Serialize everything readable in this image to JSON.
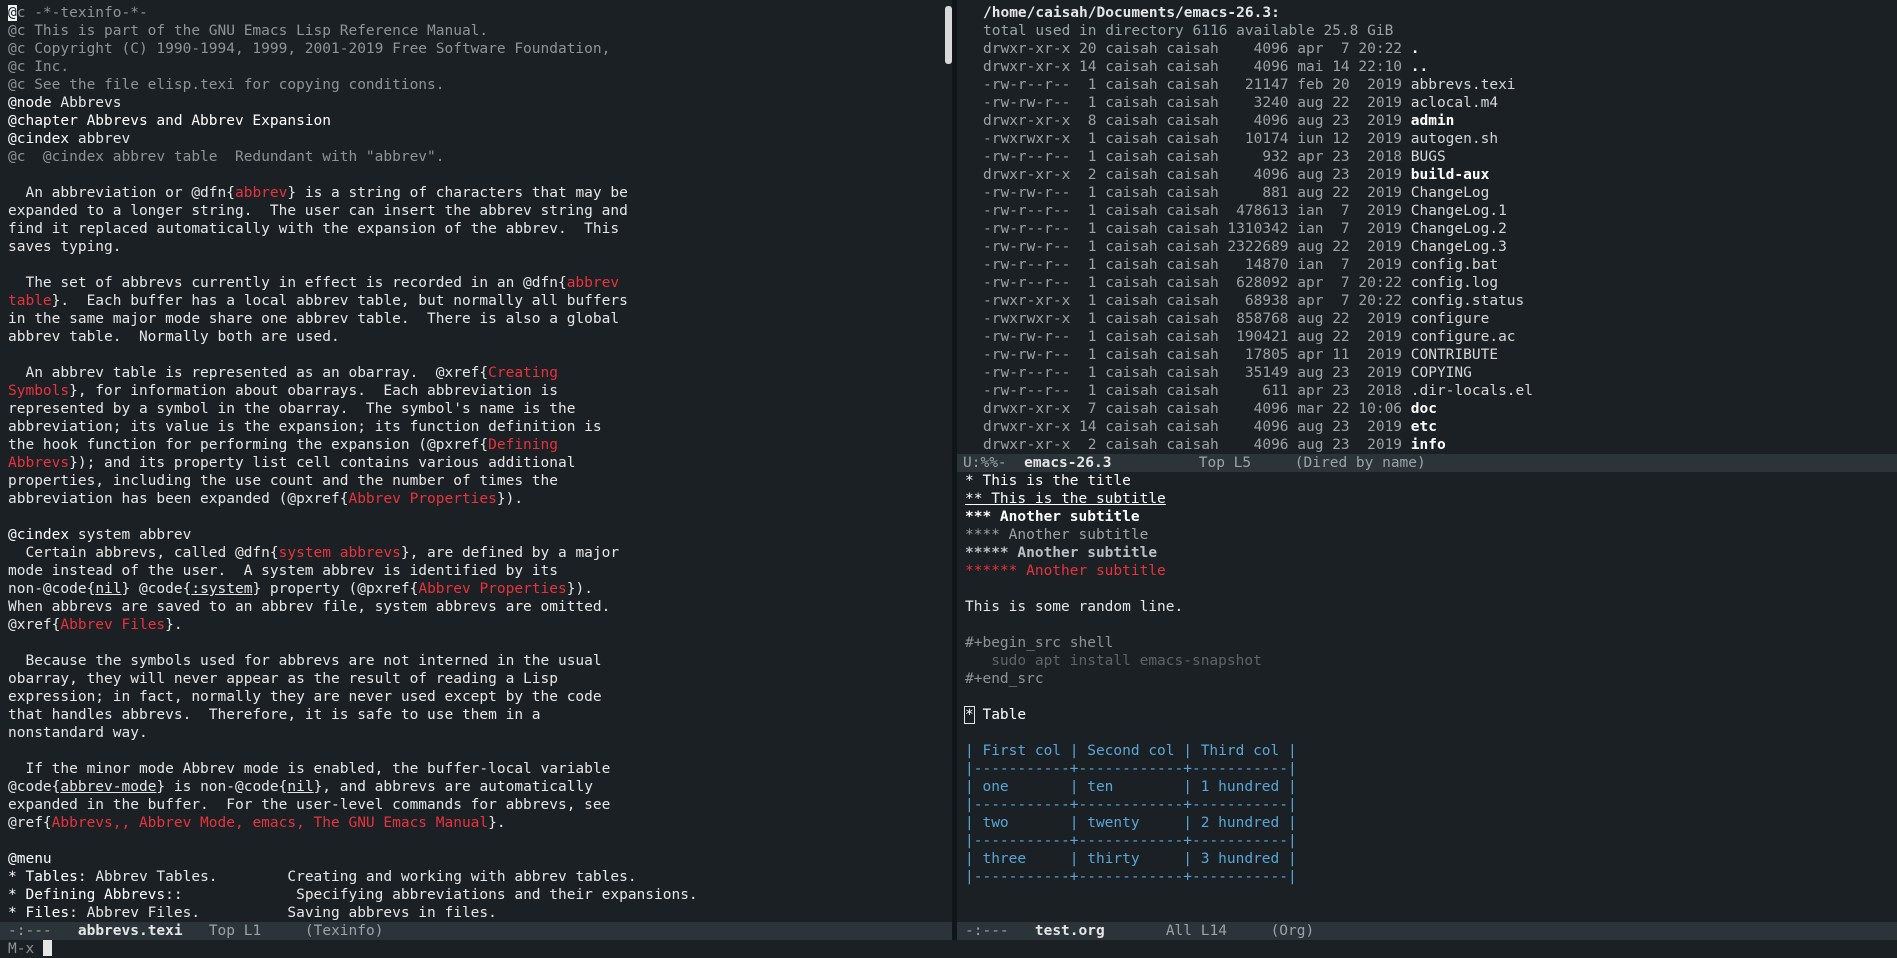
{
  "left": {
    "lines": [
      [
        {
          "t": "@c -*-texinfo-*-",
          "c": "cm"
        }
      ],
      [
        {
          "t": "@c This is part of the GNU Emacs Lisp Reference Manual.",
          "c": "cm"
        }
      ],
      [
        {
          "t": "@c Copyright (C) 1990-1994, 1999, 2001-2019 Free Software Foundation,",
          "c": "cm"
        }
      ],
      [
        {
          "t": "@c Inc.",
          "c": "cm"
        }
      ],
      [
        {
          "t": "@c See the file elisp.texi for copying conditions.",
          "c": "cm"
        }
      ],
      [
        {
          "t": "@node ",
          "c": "kw"
        },
        {
          "t": "Abbrevs"
        }
      ],
      [
        {
          "t": "@chapter Abbrevs and Abbrev Expansion",
          "c": "kw"
        }
      ],
      [
        {
          "t": "@cindex ",
          "c": "kw"
        },
        {
          "t": "abbrev"
        }
      ],
      [
        {
          "t": "@c  @cindex abbrev table  Redundant with \"abbrev\".",
          "c": "cm"
        }
      ],
      [
        {
          "t": ""
        }
      ],
      [
        {
          "t": "  An abbreviation or @dfn{"
        },
        {
          "t": "abbrev",
          "c": "red"
        },
        {
          "t": "} is a string of characters that may be"
        }
      ],
      [
        {
          "t": "expanded to a longer string.  The user can insert the abbrev string and"
        }
      ],
      [
        {
          "t": "find it replaced automatically with the expansion of the abbrev.  This"
        }
      ],
      [
        {
          "t": "saves typing."
        }
      ],
      [
        {
          "t": ""
        }
      ],
      [
        {
          "t": "  The set of abbrevs currently in effect is recorded in an @dfn{"
        },
        {
          "t": "abbrev",
          "c": "red"
        }
      ],
      [
        {
          "t": "table",
          "c": "red"
        },
        {
          "t": "}.  Each buffer has a local abbrev table, but normally all buffers"
        }
      ],
      [
        {
          "t": "in the same major mode share one abbrev table.  There is also a global"
        }
      ],
      [
        {
          "t": "abbrev table.  Normally both are used."
        }
      ],
      [
        {
          "t": ""
        }
      ],
      [
        {
          "t": "  An abbrev table is represented as an obarray.  @xref{"
        },
        {
          "t": "Creating",
          "c": "red"
        }
      ],
      [
        {
          "t": "Symbols",
          "c": "red"
        },
        {
          "t": "}, for information about obarrays.  Each abbreviation is"
        }
      ],
      [
        {
          "t": "represented by a symbol in the obarray.  The symbol's name is the"
        }
      ],
      [
        {
          "t": "abbreviation; its value is the expansion; its function definition is"
        }
      ],
      [
        {
          "t": "the hook function for performing the expansion (@pxref{"
        },
        {
          "t": "Defining",
          "c": "red"
        }
      ],
      [
        {
          "t": "Abbrevs",
          "c": "red"
        },
        {
          "t": "}); and its property list cell contains various additional"
        }
      ],
      [
        {
          "t": "properties, including the use count and the number of times the"
        }
      ],
      [
        {
          "t": "abbreviation has been expanded (@pxref{"
        },
        {
          "t": "Abbrev Properties",
          "c": "red"
        },
        {
          "t": "})."
        }
      ],
      [
        {
          "t": ""
        }
      ],
      [
        {
          "t": "@cindex ",
          "c": "kw"
        },
        {
          "t": "system abbrev"
        }
      ],
      [
        {
          "t": "  Certain abbrevs, called @dfn{"
        },
        {
          "t": "system abbrevs",
          "c": "red"
        },
        {
          "t": "}, are defined by a major"
        }
      ],
      [
        {
          "t": "mode instead of the user.  A system abbrev is identified by its"
        }
      ],
      [
        {
          "t": "non-@code{"
        },
        {
          "t": "nil",
          "c": "ul"
        },
        {
          "t": "} @code{"
        },
        {
          "t": ":system",
          "c": "ul"
        },
        {
          "t": "} property (@pxref{"
        },
        {
          "t": "Abbrev Properties",
          "c": "red"
        },
        {
          "t": "})."
        }
      ],
      [
        {
          "t": "When abbrevs are saved to an abbrev file, system abbrevs are omitted."
        }
      ],
      [
        {
          "t": "@xref{"
        },
        {
          "t": "Abbrev Files",
          "c": "red"
        },
        {
          "t": "}."
        }
      ],
      [
        {
          "t": ""
        }
      ],
      [
        {
          "t": "  Because the symbols used for abbrevs are not interned in the usual"
        }
      ],
      [
        {
          "t": "obarray, they will never appear as the result of reading a Lisp"
        }
      ],
      [
        {
          "t": "expression; in fact, normally they are never used except by the code"
        }
      ],
      [
        {
          "t": "that handles abbrevs.  Therefore, it is safe to use them in a"
        }
      ],
      [
        {
          "t": "nonstandard way."
        }
      ],
      [
        {
          "t": ""
        }
      ],
      [
        {
          "t": "  If the minor mode Abbrev mode is enabled, the buffer-local variable"
        }
      ],
      [
        {
          "t": "@code{"
        },
        {
          "t": "abbrev-mode",
          "c": "ul"
        },
        {
          "t": "} is non-@code{"
        },
        {
          "t": "nil",
          "c": "ul"
        },
        {
          "t": "}, and abbrevs are automatically"
        }
      ],
      [
        {
          "t": "expanded in the buffer.  For the user-level commands for abbrevs, see"
        }
      ],
      [
        {
          "t": "@ref{"
        },
        {
          "t": "Abbrevs,, Abbrev Mode, emacs, The GNU Emacs Manual",
          "c": "red"
        },
        {
          "t": "}."
        }
      ],
      [
        {
          "t": ""
        }
      ],
      [
        {
          "t": "@menu",
          "c": "kw"
        }
      ],
      [
        {
          "t": "* Tables: ",
          "c": "kw"
        },
        {
          "t": "Abbrev Tables.        Creating and working with abbrev tables."
        }
      ],
      [
        {
          "t": "* Defining Abbrevs::",
          "c": "kw"
        },
        {
          "t": "             Specifying abbreviations and their expansions."
        }
      ],
      [
        {
          "t": "* Files: ",
          "c": "kw"
        },
        {
          "t": "Abbrev Files.          Saving abbrevs in files."
        }
      ]
    ],
    "modeline": {
      "status": "-:---",
      "buffer": "abbrevs.texi",
      "position": "Top L1",
      "mode": "(Texinfo)"
    }
  },
  "dired": {
    "header": "/home/caisah/Documents/emacs-26.3:",
    "total": "total used in directory 6116 available 25.8 GiB",
    "entries": [
      {
        "perm": "drwxr-xr-x",
        "links": "20",
        "user": "caisah",
        "group": "caisah",
        "size": "4096",
        "date": "apr  7 20:22",
        "name": ".",
        "dir": true
      },
      {
        "perm": "drwxr-xr-x",
        "links": "14",
        "user": "caisah",
        "group": "caisah",
        "size": "4096",
        "date": "mai 14 22:10",
        "name": "..",
        "dir": true
      },
      {
        "perm": "-rw-r--r--",
        "links": "1",
        "user": "caisah",
        "group": "caisah",
        "size": "21147",
        "date": "feb 20  2019",
        "name": "abbrevs.texi",
        "dir": false
      },
      {
        "perm": "-rw-rw-r--",
        "links": "1",
        "user": "caisah",
        "group": "caisah",
        "size": "3240",
        "date": "aug 22  2019",
        "name": "aclocal.m4",
        "dir": false
      },
      {
        "perm": "drwxr-xr-x",
        "links": "8",
        "user": "caisah",
        "group": "caisah",
        "size": "4096",
        "date": "aug 23  2019",
        "name": "admin",
        "dir": true
      },
      {
        "perm": "-rwxrwxr-x",
        "links": "1",
        "user": "caisah",
        "group": "caisah",
        "size": "10174",
        "date": "iun 12  2019",
        "name": "autogen.sh",
        "dir": false
      },
      {
        "perm": "-rw-r--r--",
        "links": "1",
        "user": "caisah",
        "group": "caisah",
        "size": "932",
        "date": "apr 23  2018",
        "name": "BUGS",
        "dir": false
      },
      {
        "perm": "drwxr-xr-x",
        "links": "2",
        "user": "caisah",
        "group": "caisah",
        "size": "4096",
        "date": "aug 23  2019",
        "name": "build-aux",
        "dir": true
      },
      {
        "perm": "-rw-rw-r--",
        "links": "1",
        "user": "caisah",
        "group": "caisah",
        "size": "881",
        "date": "aug 22  2019",
        "name": "ChangeLog",
        "dir": false
      },
      {
        "perm": "-rw-r--r--",
        "links": "1",
        "user": "caisah",
        "group": "caisah",
        "size": "478613",
        "date": "ian  7  2019",
        "name": "ChangeLog.1",
        "dir": false
      },
      {
        "perm": "-rw-r--r--",
        "links": "1",
        "user": "caisah",
        "group": "caisah",
        "size": "1310342",
        "date": "ian  7  2019",
        "name": "ChangeLog.2",
        "dir": false
      },
      {
        "perm": "-rw-rw-r--",
        "links": "1",
        "user": "caisah",
        "group": "caisah",
        "size": "2322689",
        "date": "aug 22  2019",
        "name": "ChangeLog.3",
        "dir": false
      },
      {
        "perm": "-rw-r--r--",
        "links": "1",
        "user": "caisah",
        "group": "caisah",
        "size": "14870",
        "date": "ian  7  2019",
        "name": "config.bat",
        "dir": false
      },
      {
        "perm": "-rw-r--r--",
        "links": "1",
        "user": "caisah",
        "group": "caisah",
        "size": "628092",
        "date": "apr  7 20:22",
        "name": "config.log",
        "dir": false
      },
      {
        "perm": "-rwxr-xr-x",
        "links": "1",
        "user": "caisah",
        "group": "caisah",
        "size": "68938",
        "date": "apr  7 20:22",
        "name": "config.status",
        "dir": false
      },
      {
        "perm": "-rwxrwxr-x",
        "links": "1",
        "user": "caisah",
        "group": "caisah",
        "size": "858768",
        "date": "aug 22  2019",
        "name": "configure",
        "dir": false
      },
      {
        "perm": "-rw-rw-r--",
        "links": "1",
        "user": "caisah",
        "group": "caisah",
        "size": "190421",
        "date": "aug 22  2019",
        "name": "configure.ac",
        "dir": false
      },
      {
        "perm": "-rw-rw-r--",
        "links": "1",
        "user": "caisah",
        "group": "caisah",
        "size": "17805",
        "date": "apr 11  2019",
        "name": "CONTRIBUTE",
        "dir": false
      },
      {
        "perm": "-rw-r--r--",
        "links": "1",
        "user": "caisah",
        "group": "caisah",
        "size": "35149",
        "date": "aug 23  2019",
        "name": "COPYING",
        "dir": false
      },
      {
        "perm": "-rw-r--r--",
        "links": "1",
        "user": "caisah",
        "group": "caisah",
        "size": "611",
        "date": "apr 23  2018",
        "name": ".dir-locals.el",
        "dir": false
      },
      {
        "perm": "drwxr-xr-x",
        "links": "7",
        "user": "caisah",
        "group": "caisah",
        "size": "4096",
        "date": "mar 22 10:06",
        "name": "doc",
        "dir": true
      },
      {
        "perm": "drwxr-xr-x",
        "links": "14",
        "user": "caisah",
        "group": "caisah",
        "size": "4096",
        "date": "aug 23  2019",
        "name": "etc",
        "dir": true
      },
      {
        "perm": "drwxr-xr-x",
        "links": "2",
        "user": "caisah",
        "group": "caisah",
        "size": "4096",
        "date": "aug 23  2019",
        "name": "info",
        "dir": true
      }
    ],
    "modeline": {
      "status": "U:%%-",
      "buffer": "emacs-26.3",
      "position": "Top L5",
      "mode": "(Dired by name)"
    }
  },
  "org": {
    "lines": [
      {
        "t": "* This is the title",
        "c": "org1"
      },
      {
        "t": "** This is the subtitle",
        "c": "org2"
      },
      {
        "t": "*** Another subtitle",
        "c": "org3"
      },
      {
        "t": "**** Another subtitle",
        "c": "org4"
      },
      {
        "t": "***** Another subtitle",
        "c": "org5"
      },
      {
        "t": "****** Another subtitle",
        "c": "org6"
      },
      {
        "t": "",
        "c": ""
      },
      {
        "t": "This is some random line.",
        "c": ""
      },
      {
        "t": "",
        "c": ""
      },
      {
        "t": "#+begin_src shell",
        "c": "src"
      },
      {
        "t": "   sudo apt install emacs-snapshot",
        "c": "srcbody"
      },
      {
        "t": "#+end_src",
        "c": "src"
      },
      {
        "t": "",
        "c": ""
      },
      {
        "t": "* Table",
        "c": "org1",
        "cursor": true
      },
      {
        "t": "",
        "c": ""
      },
      {
        "t": "| First col | Second col | Third col |",
        "c": "tbl"
      },
      {
        "t": "|-----------+------------+-----------|",
        "c": "tbl"
      },
      {
        "t": "| one       | ten        | 1 hundred |",
        "c": "tbl"
      },
      {
        "t": "|-----------+------------+-----------|",
        "c": "tbl"
      },
      {
        "t": "| two       | twenty     | 2 hundred |",
        "c": "tbl"
      },
      {
        "t": "|-----------+------------+-----------|",
        "c": "tbl"
      },
      {
        "t": "| three     | thirty     | 3 hundred |",
        "c": "tbl"
      },
      {
        "t": "|-----------+------------+-----------|",
        "c": "tbl"
      }
    ],
    "modeline": {
      "status": "-:---",
      "buffer": "test.org",
      "position": "All L14",
      "mode": "(Org)"
    }
  },
  "minibuffer": {
    "prompt": "M-x "
  }
}
